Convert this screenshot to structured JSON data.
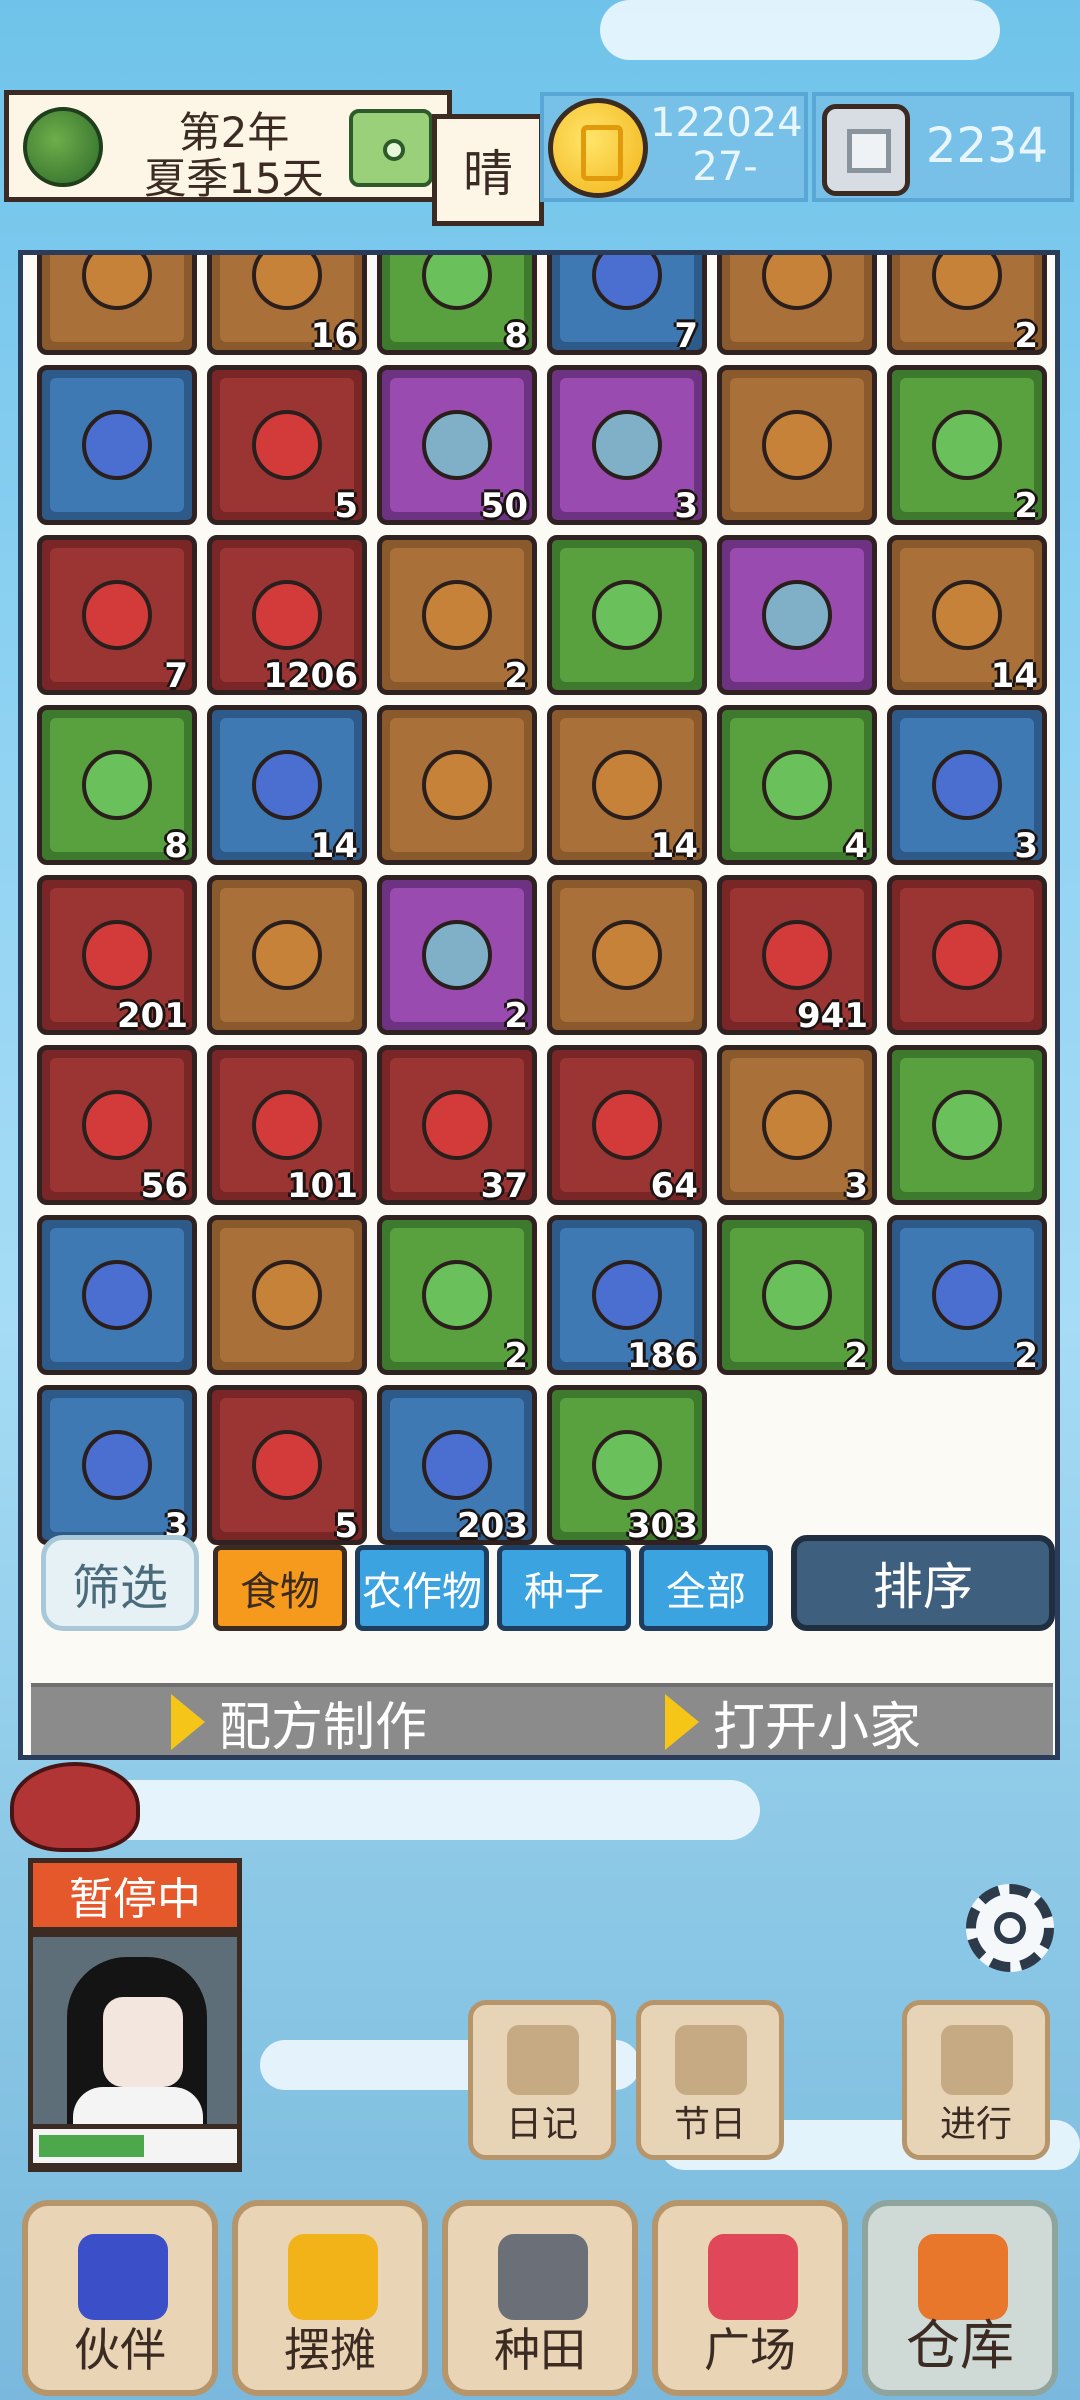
{
  "topbar": {
    "year": "第2年",
    "season_day": "夏季15天",
    "weather": "晴",
    "coins_line1": "122024",
    "coins_line2": "27-",
    "gems": "2234"
  },
  "inventory": {
    "rows": [
      [
        {
          "color": "brown",
          "qty": ""
        },
        {
          "color": "brown",
          "qty": "16"
        },
        {
          "color": "green",
          "qty": "8"
        },
        {
          "color": "blue",
          "qty": "7"
        },
        {
          "color": "brown",
          "qty": ""
        },
        {
          "color": "brown",
          "qty": "2"
        }
      ],
      [
        {
          "color": "blue",
          "qty": ""
        },
        {
          "color": "red",
          "qty": "5"
        },
        {
          "color": "purple",
          "qty": "50"
        },
        {
          "color": "purple",
          "qty": "3"
        },
        {
          "color": "brown",
          "qty": ""
        },
        {
          "color": "green",
          "qty": "2"
        }
      ],
      [
        {
          "color": "red",
          "qty": "7"
        },
        {
          "color": "red",
          "qty": "1206"
        },
        {
          "color": "brown",
          "qty": "2"
        },
        {
          "color": "green",
          "qty": ""
        },
        {
          "color": "purple",
          "qty": ""
        },
        {
          "color": "brown",
          "qty": "14"
        }
      ],
      [
        {
          "color": "green",
          "qty": "8"
        },
        {
          "color": "blue",
          "qty": "14"
        },
        {
          "color": "brown",
          "qty": ""
        },
        {
          "color": "brown",
          "qty": "14"
        },
        {
          "color": "green",
          "qty": "4"
        },
        {
          "color": "blue",
          "qty": "3"
        }
      ],
      [
        {
          "color": "red",
          "qty": "201"
        },
        {
          "color": "brown",
          "qty": ""
        },
        {
          "color": "purple",
          "qty": "2"
        },
        {
          "color": "brown",
          "qty": ""
        },
        {
          "color": "red",
          "qty": "941"
        },
        {
          "color": "red",
          "qty": ""
        }
      ],
      [
        {
          "color": "red",
          "qty": "56"
        },
        {
          "color": "red",
          "qty": "101"
        },
        {
          "color": "red",
          "qty": "37"
        },
        {
          "color": "red",
          "qty": "64"
        },
        {
          "color": "brown",
          "qty": "3"
        },
        {
          "color": "green",
          "qty": ""
        }
      ],
      [
        {
          "color": "blue",
          "qty": ""
        },
        {
          "color": "brown",
          "qty": ""
        },
        {
          "color": "green",
          "qty": "2"
        },
        {
          "color": "blue",
          "qty": "186"
        },
        {
          "color": "green",
          "qty": "2"
        },
        {
          "color": "blue",
          "qty": "2"
        }
      ],
      [
        {
          "color": "blue",
          "qty": "3"
        },
        {
          "color": "red",
          "qty": "5"
        },
        {
          "color": "blue",
          "qty": "203"
        },
        {
          "color": "green",
          "qty": "303"
        }
      ]
    ],
    "item_colors": {
      "brown": "#c7823a",
      "red": "#d33b3b",
      "green": "#6ac05a",
      "blue": "#4a6fd0",
      "purple": "#7fb0c8"
    }
  },
  "filters": {
    "filter_label": "筛选",
    "tabs": [
      {
        "label": "食物",
        "active": true
      },
      {
        "label": "农作物",
        "active": false
      },
      {
        "label": "种子",
        "active": false
      },
      {
        "label": "全部",
        "active": false
      }
    ],
    "sort_label": "排序"
  },
  "actions": {
    "recipe": "配方制作",
    "open_home": "打开小家"
  },
  "status": {
    "paused": "暂停中",
    "energy_fraction": 0.55
  },
  "side_buttons": {
    "diary": "日记",
    "festival": "节日",
    "proceed": "进行"
  },
  "bottom_nav": [
    {
      "label": "伙伴",
      "icon": "partner-icon",
      "color": "#3a4fc8",
      "active": false
    },
    {
      "label": "摆摊",
      "icon": "stall-icon",
      "color": "#f2b318",
      "active": false
    },
    {
      "label": "种田",
      "icon": "farming-icon",
      "color": "#6a6f78",
      "active": false
    },
    {
      "label": "广场",
      "icon": "plaza-icon",
      "color": "#e0485a",
      "active": false
    },
    {
      "label": "仓库",
      "icon": "warehouse-icon",
      "color": "#e8762b",
      "active": true
    }
  ]
}
